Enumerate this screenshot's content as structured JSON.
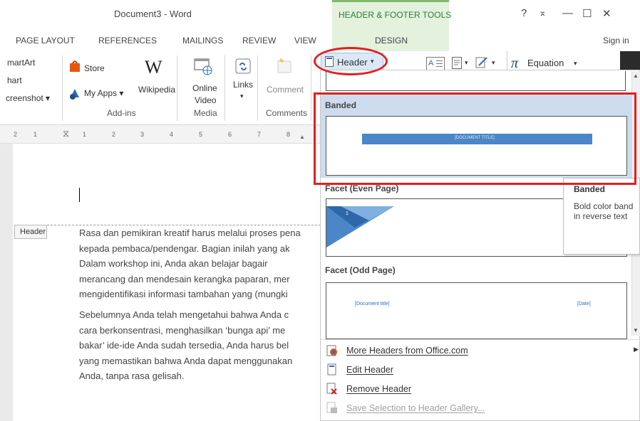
{
  "window": {
    "doc_title": "Document3 - Word",
    "contextual_title": "HEADER & FOOTER TOOLS",
    "controls": {
      "help": "?",
      "restore": "⌅",
      "minimize": "—",
      "maximize": "☐",
      "close": "✕"
    }
  },
  "tabs": [
    "PAGE LAYOUT",
    "REFERENCES",
    "MAILINGS",
    "REVIEW",
    "VIEW"
  ],
  "design_tab": "DESIGN",
  "signin": "Sign in",
  "ribbon": {
    "smartart": "martArt",
    "chart": "hart",
    "screenshot": "creenshot",
    "store": "Store",
    "my_apps": "My Apps",
    "wikipedia": "Wikipedia",
    "online_video_1": "Online",
    "online_video_2": "Video",
    "links": "Links",
    "comment": "Comment",
    "header": "Header",
    "equation": "Equation",
    "groups": {
      "addins": "Add-ins",
      "media": "Media",
      "comments": "Comments"
    }
  },
  "ruler": {
    "ticks": [
      "2",
      "1",
      "1",
      "2",
      "3",
      "4",
      "5",
      "6",
      "7",
      "8"
    ]
  },
  "document": {
    "header_tag": "Header",
    "para1": [
      "Rasa dan pemikiran kreatif harus melalui proses pena",
      "kepada pembaca/pendengar. Bagian inilah yang ak",
      "Dalam workshop ini, Anda akan belajar bagair",
      "merancang dan mendesain kerangka paparan, mer",
      "mengidentifikasi informasi tambahan yang (mungki"
    ],
    "para2": [
      "Sebelumnya Anda telah mengetahui bahwa Anda c",
      "cara berkonsentrasi, menghasilkan ‘bunga api’ me",
      "bakar’ ide-ide Anda sudah tersedia, Anda harus bel",
      "yang memastikan bahwa Anda dapat menggunakan",
      "Anda, tanpa rasa gelisah."
    ]
  },
  "gallery": {
    "groups": [
      {
        "name": "Banded",
        "thumb_text": "[DOCUMENT TITLE]"
      },
      {
        "name": "Facet (Even Page)",
        "thumb_text": "1"
      },
      {
        "name": "Facet (Odd Page)",
        "thumb_left": "[Document title]",
        "thumb_right": "[Date]"
      }
    ]
  },
  "tooltip": {
    "title": "Banded",
    "body_1": "Bold color band",
    "body_2": "in reverse text"
  },
  "menu": [
    {
      "label": "More Headers from Office.com",
      "icon": "globe-icon"
    },
    {
      "label": "Edit Header",
      "icon": "page-icon"
    },
    {
      "label": "Remove Header",
      "icon": "remove-header-icon"
    },
    {
      "label": "Save Selection to Header Gallery...",
      "icon": "save-gallery-icon",
      "disabled": true
    }
  ],
  "colors": {
    "accent_green": "#7fb86a",
    "highlight_blue": "#cddcef",
    "band_blue": "#4a86c8",
    "annotation_red": "#e02020"
  }
}
